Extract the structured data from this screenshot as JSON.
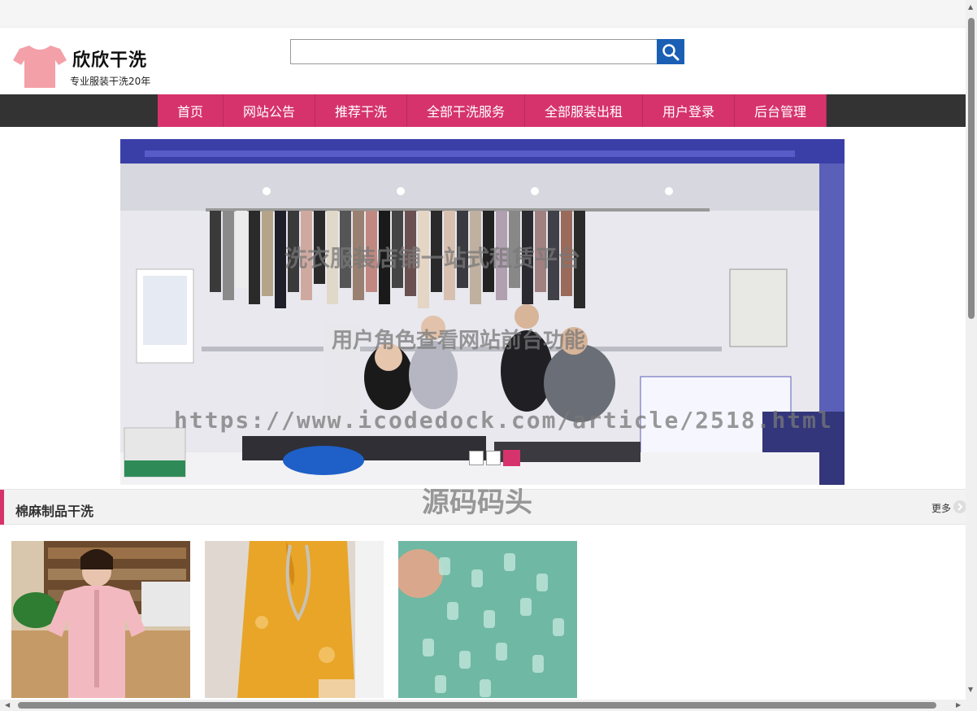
{
  "header": {
    "site_title": "欣欣干洗",
    "site_subtitle": "专业服装干洗20年",
    "search": {
      "value": "",
      "placeholder": ""
    }
  },
  "nav": {
    "items": [
      {
        "label": "首页"
      },
      {
        "label": "网站公告"
      },
      {
        "label": "推荐干洗"
      },
      {
        "label": "全部干洗服务"
      },
      {
        "label": "全部服装出租"
      },
      {
        "label": "用户登录"
      },
      {
        "label": "后台管理"
      }
    ]
  },
  "banner": {
    "active_slide": 3,
    "slide_count": 3
  },
  "watermarks": {
    "line1": "洗衣服装店铺一站式租赁平台",
    "line2": "用户角色查看网站前台功能",
    "line3": "https://www.icodedock.com/article/2518.html",
    "line4": "源码码头"
  },
  "section": {
    "title": "棉麻制品干洗",
    "more_label": "更多"
  },
  "colors": {
    "accent": "#d6336c",
    "nav_bg": "#333333",
    "search_button": "#1a5fb4"
  }
}
